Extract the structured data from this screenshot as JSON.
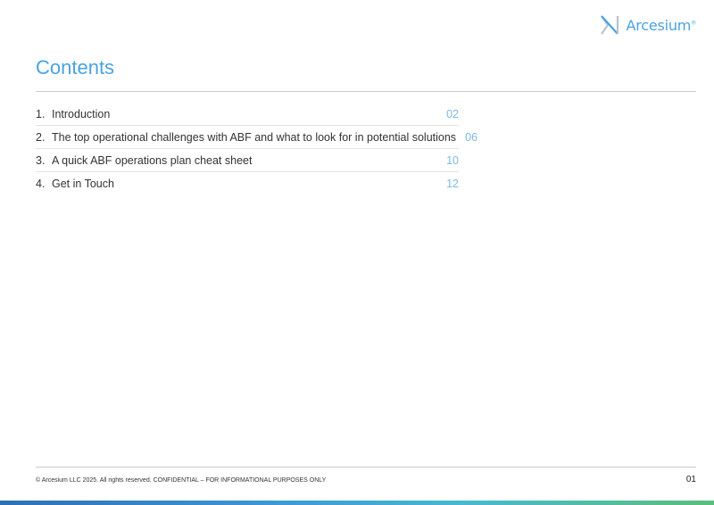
{
  "brand": {
    "name": "Arcesium",
    "trademark": "®",
    "icon": "arcesium-logo-icon"
  },
  "page_title": "Contents",
  "toc": [
    {
      "number": "1.",
      "label": "Introduction",
      "page": "02"
    },
    {
      "number": "2.",
      "label": "The top operational challenges with ABF and what to look for in potential solutions",
      "page": "06"
    },
    {
      "number": "3.",
      "label": "A quick ABF operations plan cheat sheet",
      "page": "10"
    },
    {
      "number": "4.",
      "label": "Get in Touch",
      "page": "12"
    }
  ],
  "footer": {
    "copyright": "© Arcesium LLC 2025. All rights reserved. CONFIDENTIAL – FOR INFORMATIONAL PURPOSES ONLY",
    "page_number": "01"
  },
  "colors": {
    "accent": "#4aa3df",
    "page_number_link": "#7db8e3",
    "rule": "#c9c9c9"
  }
}
